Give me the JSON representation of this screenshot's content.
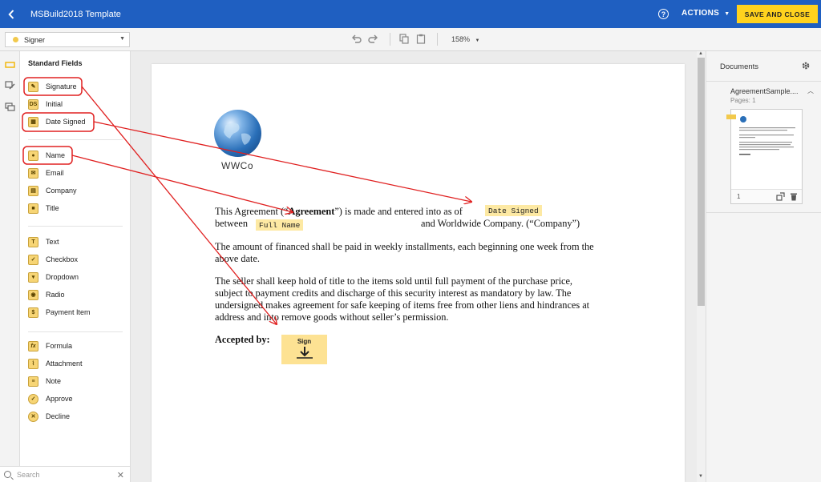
{
  "topbar": {
    "title": "MSBuild2018 Template",
    "help_icon": "?",
    "actions_label": "ACTIONS",
    "save_label": "SAVE AND CLOSE"
  },
  "toolbar": {
    "signer": "Signer",
    "zoom": "158%"
  },
  "fields": {
    "title": "Standard Fields",
    "groups": [
      [
        {
          "label": "Signature",
          "icon": "pen-icon"
        },
        {
          "label": "Initial",
          "icon": "initial-icon",
          "glyph": "DS"
        },
        {
          "label": "Date Signed",
          "icon": "calendar-icon"
        }
      ],
      [
        {
          "label": "Name",
          "icon": "person-icon"
        },
        {
          "label": "Email",
          "icon": "envelope-icon"
        },
        {
          "label": "Company",
          "icon": "building-icon"
        },
        {
          "label": "Title",
          "icon": "briefcase-icon"
        }
      ],
      [
        {
          "label": "Text",
          "icon": "text-icon",
          "glyph": "T"
        },
        {
          "label": "Checkbox",
          "icon": "checkbox-icon"
        },
        {
          "label": "Dropdown",
          "icon": "dropdown-icon"
        },
        {
          "label": "Radio",
          "icon": "radio-icon"
        },
        {
          "label": "Payment Item",
          "icon": "payment-icon"
        }
      ],
      [
        {
          "label": "Formula",
          "icon": "formula-icon",
          "glyph": "fx"
        },
        {
          "label": "Attachment",
          "icon": "paperclip-icon"
        },
        {
          "label": "Note",
          "icon": "note-icon"
        },
        {
          "label": "Approve",
          "icon": "check-circle-icon"
        },
        {
          "label": "Decline",
          "icon": "x-circle-icon"
        }
      ]
    ],
    "search_placeholder": "Search"
  },
  "document": {
    "logo_text": "WWCo",
    "p1_a": "This Agreement (“",
    "p1_bold": "Agreement",
    "p1_b": "”) is made and entered into as of",
    "p1_c": "between",
    "p1_d": "and Worldwide Company. (“Company”)",
    "p2_line1": "The amount of financed shall be paid in weekly installments, each beginning one week from the",
    "p2_line2": "above date.",
    "p3_line1": "The seller shall keep hold of title to the items sold until full payment of the purchase price,",
    "p3_line2": "subject to payment credits and discharge of this security interest as mandatory by law. The",
    "p3_line3": "undersigned makes agreement for safe keeping of items free from other liens and hindrances at",
    "p3_line4": "address and into remove goods without seller’s permission.",
    "accepted": "Accepted by:",
    "tag_date": "Date Signed",
    "tag_name": "Full Name",
    "tag_sign": "Sign"
  },
  "documents_panel": {
    "title": "Documents",
    "doc_name": "AgreementSample....",
    "pages": "Pages: 1",
    "page_number": "1"
  },
  "colors": {
    "topbar": "#1f5fc1",
    "save_button": "#ffd21e",
    "field_tag": "#fde9a3",
    "annotation": "#e02020"
  }
}
